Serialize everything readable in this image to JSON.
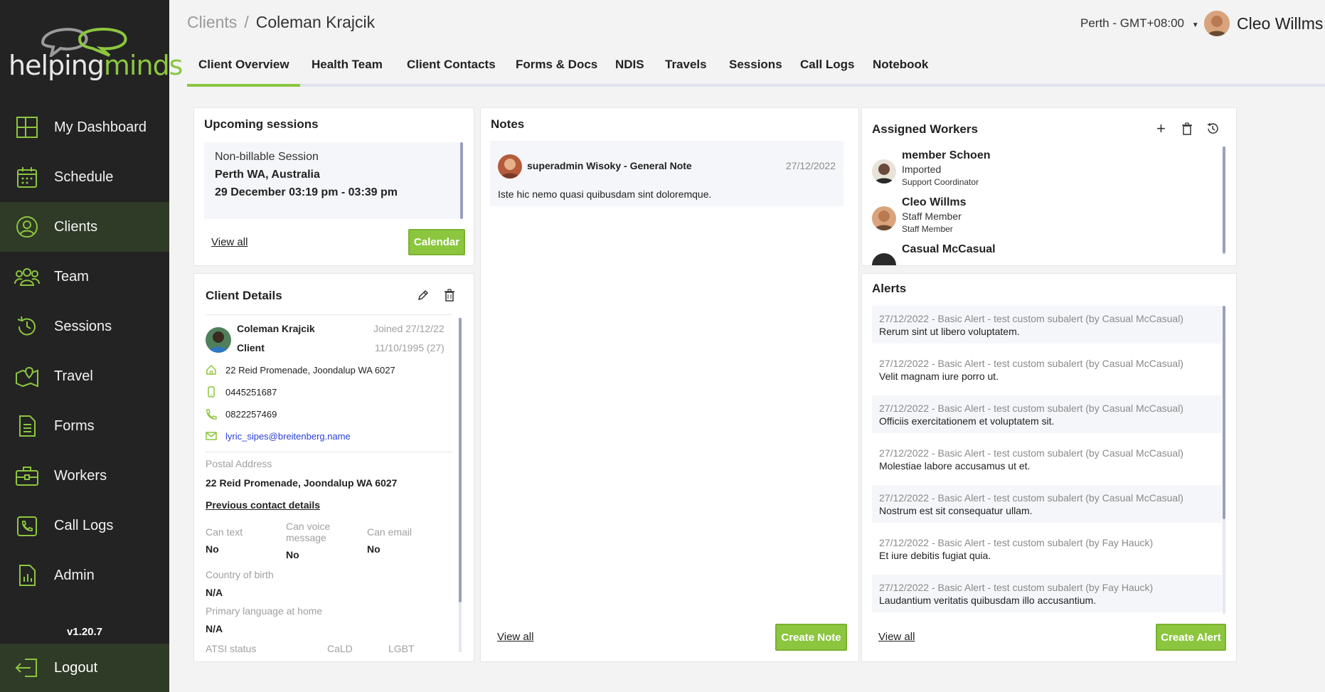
{
  "brand": {
    "logo_text_1": "helping",
    "logo_text_2": "minds",
    "accent": "#8cc63f"
  },
  "sidebar": {
    "items": [
      {
        "label": "My Dashboard",
        "icon": "dashboard-grid-icon"
      },
      {
        "label": "Schedule",
        "icon": "calendar-icon"
      },
      {
        "label": "Clients",
        "icon": "user-circle-icon"
      },
      {
        "label": "Team",
        "icon": "team-icon"
      },
      {
        "label": "Sessions",
        "icon": "history-icon"
      },
      {
        "label": "Travel",
        "icon": "map-pin-icon"
      },
      {
        "label": "Forms",
        "icon": "document-icon"
      },
      {
        "label": "Workers",
        "icon": "briefcase-icon"
      },
      {
        "label": "Call Logs",
        "icon": "phone-icon"
      },
      {
        "label": "Admin",
        "icon": "chart-file-icon"
      }
    ],
    "version": "v1.20.7",
    "logout": "Logout"
  },
  "header": {
    "crumb": "Clients",
    "sep": "/",
    "current": "Coleman Krajcik",
    "timezone": "Perth - GMT+08:00",
    "user_name": "Cleo Willms"
  },
  "tabs": [
    "Client Overview",
    "Health Team",
    "Client Contacts",
    "Forms & Docs",
    "NDIS",
    "Travels",
    "Sessions",
    "Call Logs",
    "Notebook"
  ],
  "sessions": {
    "title": "Upcoming sessions",
    "type": "Non-billable Session",
    "location": "Perth WA, Australia",
    "time": "29 December 03:19 pm - 03:39 pm",
    "view_all": "View all",
    "calendar": "Calendar"
  },
  "client_details": {
    "title": "Client Details",
    "name": "Coleman Krajcik",
    "role": "Client",
    "joined": "Joined 27/12/22",
    "dob": "11/10/1995 (27)",
    "address": "22 Reid Promenade, Joondalup WA 6027",
    "mobile": "0445251687",
    "phone": "0822257469",
    "email": "lyric_sipes@breitenberg.name",
    "postal_label": "Postal Address",
    "postal_value": "22 Reid Promenade, Joondalup WA 6027",
    "previous_link": "Previous contact details",
    "can_text_label": "Can text",
    "can_text": "No",
    "can_voice_label_1": "Can voice",
    "can_voice_label_2": "message",
    "can_voice": "No",
    "can_email_label": "Can email",
    "can_email": "No",
    "country_label": "Country of birth",
    "country": "N/A",
    "language_label": "Primary language at home",
    "language": "N/A",
    "atsi_label": "ATSI status",
    "cald_label": "CaLD",
    "lgbt_label": "LGBT"
  },
  "notes": {
    "title": "Notes",
    "author": "superadmin Wisoky - General Note",
    "date": "27/12/2022",
    "body": "Iste hic nemo quasi quibusdam sint doloremque.",
    "view_all": "View all",
    "create": "Create Note"
  },
  "workers": {
    "title": "Assigned Workers",
    "list": [
      {
        "name": "member Schoen",
        "status": "Imported",
        "role": "Support Coordinator"
      },
      {
        "name": "Cleo Willms",
        "status": "Staff Member",
        "role": "Staff Member"
      },
      {
        "name": "Casual McCasual",
        "status": "",
        "role": ""
      }
    ]
  },
  "alerts": {
    "title": "Alerts",
    "list": [
      {
        "header": "27/12/2022 - Basic Alert - test custom subalert (by Casual McCasual)",
        "text": "Rerum sint ut libero voluptatem."
      },
      {
        "header": "27/12/2022 - Basic Alert - test custom subalert (by Casual McCasual)",
        "text": "Velit magnam iure porro ut."
      },
      {
        "header": "27/12/2022 - Basic Alert - test custom subalert (by Casual McCasual)",
        "text": "Officiis exercitationem et voluptatem sit."
      },
      {
        "header": "27/12/2022 - Basic Alert - test custom subalert (by Casual McCasual)",
        "text": "Molestiae labore accusamus ut et."
      },
      {
        "header": "27/12/2022 - Basic Alert - test custom subalert (by Casual McCasual)",
        "text": "Nostrum est sit consequatur ullam."
      },
      {
        "header": "27/12/2022 - Basic Alert - test custom subalert (by Fay Hauck)",
        "text": "Et iure debitis fugiat quia."
      },
      {
        "header": "27/12/2022 - Basic Alert - test custom subalert (by Fay Hauck)",
        "text": "Laudantium veritatis quibusdam illo accusantium."
      }
    ],
    "view_all": "View all",
    "create": "Create Alert"
  }
}
